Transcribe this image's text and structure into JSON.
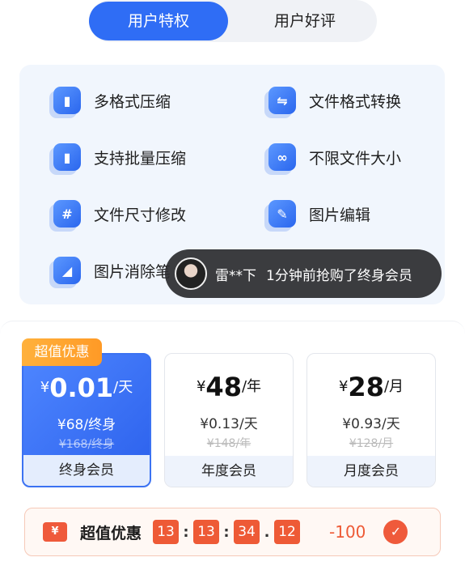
{
  "tabs": {
    "active": "用户特权",
    "inactive": "用户好评"
  },
  "features": [
    {
      "label": "多格式压缩",
      "icon": "compress-icon"
    },
    {
      "label": "文件格式转换",
      "icon": "convert-icon"
    },
    {
      "label": "支持批量压缩",
      "icon": "batch-compress-icon"
    },
    {
      "label": "不限文件大小",
      "icon": "infinity-icon"
    },
    {
      "label": "文件尺寸修改",
      "icon": "resize-icon"
    },
    {
      "label": "图片编辑",
      "icon": "edit-icon"
    },
    {
      "label": "图片消除笔",
      "icon": "eraser-icon"
    }
  ],
  "toast": {
    "user": "雷**下",
    "message": "1分钟前抢购了终身会员"
  },
  "plans": {
    "badge": "超值优惠",
    "lifetime": {
      "currency": "¥",
      "price": "0.01",
      "unit": "/天",
      "sub": "¥68/终身",
      "orig": "¥168/终身",
      "name": "终身会员"
    },
    "yearly": {
      "currency": "¥",
      "price": "48",
      "unit": "/年",
      "sub": "¥0.13/天",
      "orig": "¥148/年",
      "name": "年度会员"
    },
    "monthly": {
      "currency": "¥",
      "price": "28",
      "unit": "/月",
      "sub": "¥0.93/天",
      "orig": "¥128/月",
      "name": "月度会员"
    }
  },
  "countdown": {
    "ticket": "¥",
    "title": "超值优惠",
    "h": "13",
    "m": "13",
    "s": "34",
    "ms": "12",
    "sep1": ":",
    "sep2": ":",
    "sep3": ".",
    "discount": "-100",
    "check": "✓"
  },
  "colors": {
    "primary": "#2f6df5",
    "accent": "#ee5a36",
    "badge": "#ff9a26"
  }
}
